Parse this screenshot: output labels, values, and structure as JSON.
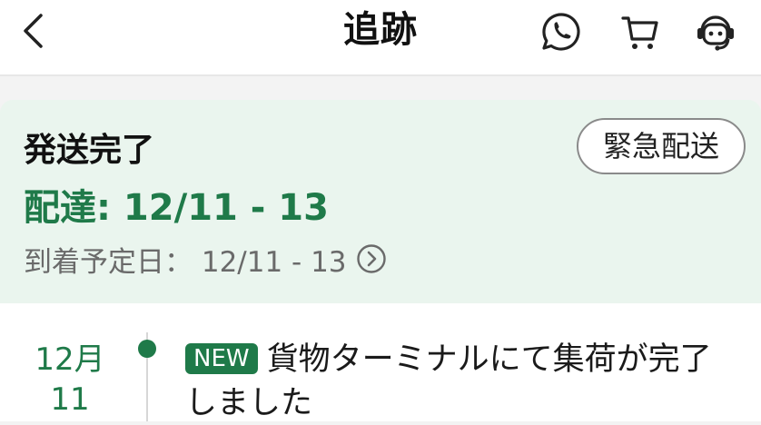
{
  "header": {
    "title": "追跡",
    "icons": [
      "chevron-left-icon",
      "whatsapp-icon",
      "cart-icon",
      "support-agent-icon"
    ]
  },
  "status": {
    "title": "発送完了",
    "urgent_button": "緊急配送",
    "delivery": "配達: 12/11 - 13",
    "eta": "到着予定日： 12/11 - 13"
  },
  "timeline": {
    "events": [
      {
        "date_month": "12月",
        "date_day": "11",
        "badge": "NEW",
        "text": "貨物ターミナルにて集荷が完了しました"
      }
    ]
  },
  "colors": {
    "accent": "#1f7a49",
    "card_bg": "#eaf5ee",
    "muted_text": "#6a6a6a"
  }
}
